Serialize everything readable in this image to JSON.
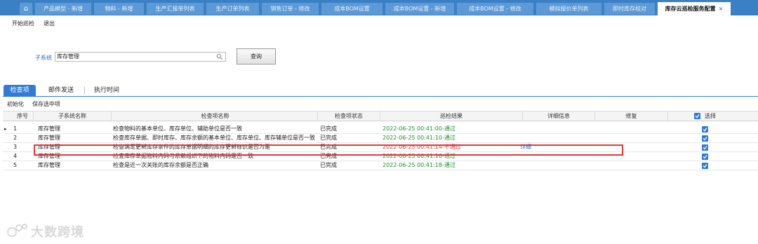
{
  "tabs": [
    {
      "label": "产品模型 - 新增"
    },
    {
      "label": "物料 - 新增"
    },
    {
      "label": "生产汇报单列表"
    },
    {
      "label": "生产订单列表"
    },
    {
      "label": "销售订单 - 修改"
    },
    {
      "label": "成本BOM设置"
    },
    {
      "label": "成本BOM设置 - 新增"
    },
    {
      "label": "成本BOM设置 - 修改"
    },
    {
      "label": "模拟报价单列表"
    },
    {
      "label": "即时库存校对"
    },
    {
      "label": "库存云巡检服务配置"
    }
  ],
  "home_icon": "home-icon",
  "toolbar": {
    "start": "开始巡检",
    "exit": "退出"
  },
  "filter": {
    "subsystem_label": "子系统",
    "subsystem_value": "库存管理",
    "query_label": "查询"
  },
  "subtabs": [
    {
      "label": "检查项"
    },
    {
      "label": "邮件发送"
    },
    {
      "label": "执行时间"
    }
  ],
  "actions": {
    "init": "初始化",
    "save_selected": "保存选中项"
  },
  "columns": {
    "index": "序号",
    "subsystem": "子系统名称",
    "item": "检查项名称",
    "status": "检查项状态",
    "result": "巡检结果",
    "detail": "详细信息",
    "repair": "修复",
    "select": "选择"
  },
  "rows": [
    {
      "index": "1",
      "subsystem": "库存管理",
      "item": "检查物料的基本单位、库存单位、辅助单位是否一致",
      "status": "已完成",
      "result": "2022-06-25 00:41:00-通过",
      "detail": "",
      "passed": true
    },
    {
      "index": "2",
      "subsystem": "库存管理",
      "item": "检查库存单据、即时库存、库存余额的基本单位、库存单位、库存辅单位是否一致（注：条",
      "status": "已完成",
      "result": "2022-06-25 00:41:10-通过",
      "detail": "",
      "passed": true
    },
    {
      "index": "3",
      "subsystem": "库存管理",
      "item": "检查满足更新库存条件的库存单据明细的库存更新标识是否为是",
      "status": "已完成",
      "result": "2022-06-25 00:41:14-不通过",
      "detail": "详细",
      "passed": false
    },
    {
      "index": "4",
      "subsystem": "库存管理",
      "item": "检查库存单据物料内码与依赖组织下的物料内码是否一致",
      "status": "已完成",
      "result": "2022-06-25 00:41:16-通过",
      "detail": "",
      "passed": true
    },
    {
      "index": "5",
      "subsystem": "库存管理",
      "item": "检查是近一次关账的库存余额是否正确",
      "status": "已完成",
      "result": "2022-06-25 00:41:18-通过",
      "detail": "",
      "passed": true
    }
  ],
  "watermark": "大数跨境",
  "colors": {
    "tabbar": "#3b7fc4",
    "accent": "#2f7bd6",
    "pass": "#1f8f2e",
    "fail": "#e33030",
    "highlight": "#e0393e"
  }
}
